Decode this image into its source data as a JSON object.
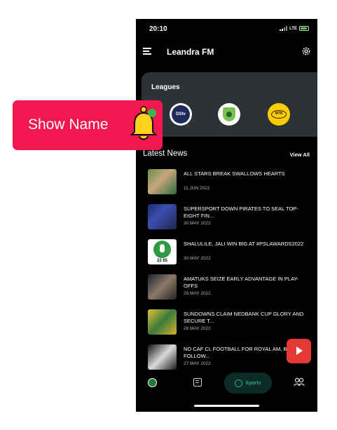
{
  "status_bar": {
    "time": "20:10",
    "network": "LTE"
  },
  "app_bar": {
    "title": "Leandra FM",
    "menu_icon": "hamburger-icon",
    "settings_icon": "gear-icon"
  },
  "leagues": {
    "title": "Leagues",
    "items": [
      {
        "name": "DStv Premiership",
        "logo_text": "DStv"
      },
      {
        "name": "Nedbank Cup"
      },
      {
        "name": "MTN8",
        "logo_text": "MTN"
      }
    ]
  },
  "latest_news": {
    "title": "Latest News",
    "view_all": "View All",
    "items": [
      {
        "title": "ALL STARS BREAK SWALLOWS HEARTS",
        "date": "11 JUN 2022"
      },
      {
        "title": "SUPERSPORT DOWN PIRATES TO SEAL TOP-EIGHT FIN...",
        "date": "30 MAY 2022"
      },
      {
        "title": "SHALULILE, JALI WIN BIG AT #PSLAWARDS2022",
        "date": "30 MAY 2022",
        "thumb_text": "22 65"
      },
      {
        "title": "AMATUKS SEIZE EARLY ADVANTAGE IN PLAY-OFFS",
        "date": "29 MAY 2022"
      },
      {
        "title": "SUNDOWNS CLAIM NEDBANK CUP GLORY AND SECURE T...",
        "date": "28 MAY 2022"
      },
      {
        "title": "NO CAF CL FOOTBALL FOR ROYAL AM, BUCS FOLLOW...",
        "date": "27 MAY 2022"
      }
    ]
  },
  "bottom_nav": {
    "active_label": "Sports",
    "items": [
      "home-icon",
      "news-icon",
      "sports-icon",
      "people-icon"
    ]
  },
  "overlay": {
    "badge_text": "Show Name",
    "badge_color": "#f2184f",
    "bell_color": "#ffd21f",
    "fab_color": "#e53935"
  },
  "colors": {
    "background": "#000000",
    "card": "#2c3236",
    "accent": "#2fa387"
  }
}
